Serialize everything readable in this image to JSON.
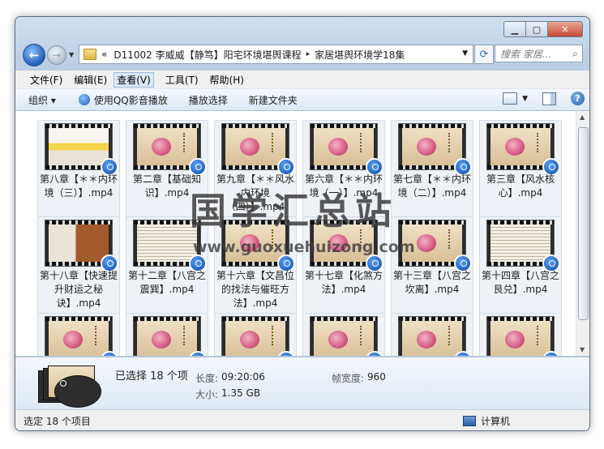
{
  "window": {
    "buttons": {
      "minimize": "▁",
      "maximize": "▢",
      "close": "✕"
    }
  },
  "nav": {
    "back_glyph": "←",
    "forward_glyph": "→",
    "address": {
      "prefix": "«",
      "crumbs": [
        "D11002 李威威【静笃】阳宅环境堪舆课程",
        "家居堪舆环境学18集"
      ],
      "separator": "▸"
    },
    "search_placeholder": "搜索 家居...",
    "refresh_icon": "refresh-icon"
  },
  "menu": [
    "文件(F)",
    "编辑(E)",
    "查看(V)",
    "工具(T)",
    "帮助(H)"
  ],
  "toolbar": {
    "organize": "组织 ▾",
    "play_qq": "使用QQ影音播放",
    "play_select": "播放选择",
    "new_folder": "新建文件夹"
  },
  "files": [
    {
      "label": "第八章【＊＊内环境（三）】.mp4",
      "thumb": "room"
    },
    {
      "label": "第二章【基础知识】.mp4",
      "thumb": "flower"
    },
    {
      "label": "第九章【＊＊风水内环境（四）】.mp4",
      "thumb": "flower"
    },
    {
      "label": "第六章【＊＊内环境（一）】.mp4",
      "thumb": "flower"
    },
    {
      "label": "第七章【＊＊内环境（二）】.mp4",
      "thumb": "flower"
    },
    {
      "label": "第三章【风水核心】.mp4",
      "thumb": "flower"
    },
    {
      "label": "第十八章【快速提升财运之秘诀】.mp4",
      "thumb": "mixed"
    },
    {
      "label": "第十二章【八宫之震巽】.mp4",
      "thumb": "doc"
    },
    {
      "label": "第十六章【文昌位的找法与催旺方法】.mp4",
      "thumb": "flower"
    },
    {
      "label": "第十七章【化煞方法】.mp4",
      "thumb": "flower"
    },
    {
      "label": "第十三章【八宫之坎离】.mp4",
      "thumb": "flower"
    },
    {
      "label": "第十四章【八宫之艮兑】.mp4",
      "thumb": "doc"
    },
    {
      "label": "",
      "thumb": "flower"
    },
    {
      "label": "",
      "thumb": "flower"
    },
    {
      "label": "",
      "thumb": "flower"
    },
    {
      "label": "",
      "thumb": "flower"
    },
    {
      "label": "",
      "thumb": "flower"
    },
    {
      "label": "",
      "thumb": "flower"
    }
  ],
  "details": {
    "selected": "已选择 18 个项",
    "length_key": "长度:",
    "length_val": "09:20:06",
    "size_key": "大小:",
    "size_val": "1.35 GB",
    "width_key": "帧宽度:",
    "width_val": "960"
  },
  "status": {
    "left": "选定 18 个项目",
    "right": "计算机"
  },
  "watermark": {
    "cn": "国学汇总站",
    "url": "www.guoxuehuizong.com"
  }
}
